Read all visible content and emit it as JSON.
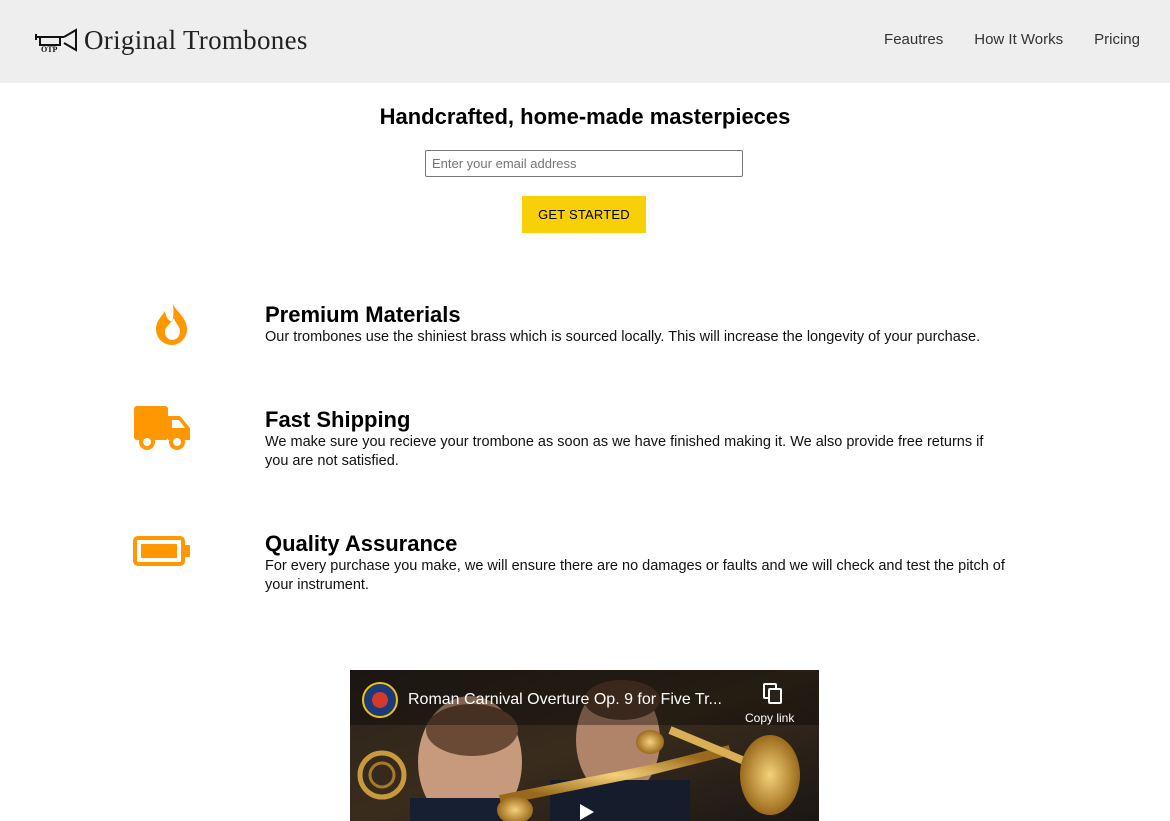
{
  "brand": {
    "name": "Original Trombones",
    "mark_letters": "OTP",
    "logo_icon": "trumpet-logo-icon"
  },
  "nav": {
    "items": [
      {
        "label": "Feautres"
      },
      {
        "label": "How It Works"
      },
      {
        "label": "Pricing"
      }
    ]
  },
  "hero": {
    "title": "Handcrafted, home-made masterpieces",
    "email_placeholder": "Enter your email address",
    "email_value": "",
    "cta_label": "GET STARTED"
  },
  "features": [
    {
      "icon": "fire-icon",
      "title": "Premium Materials",
      "text": "Our trombones use the shiniest brass which is sourced locally. This will increase the longevity of your purchase."
    },
    {
      "icon": "truck-icon",
      "title": "Fast Shipping",
      "text": "We make sure you recieve your trombone as soon as we have finished making it. We also provide free returns if you are not satisfied."
    },
    {
      "icon": "battery-full-icon",
      "title": "Quality Assurance",
      "text": "For every purchase you make, we will ensure there are no damages or faults and we will check and test the pitch of your instrument."
    }
  ],
  "video": {
    "title": "Roman Carnival Overture Op. 9 for Five Tr...",
    "copy_link_label": "Copy link",
    "play_icon": "play-icon",
    "copy_icon": "copy-icon"
  },
  "colors": {
    "header_bg": "#eeeeee",
    "accent_icon": "#ff9800",
    "cta_bg": "#f8d007"
  }
}
